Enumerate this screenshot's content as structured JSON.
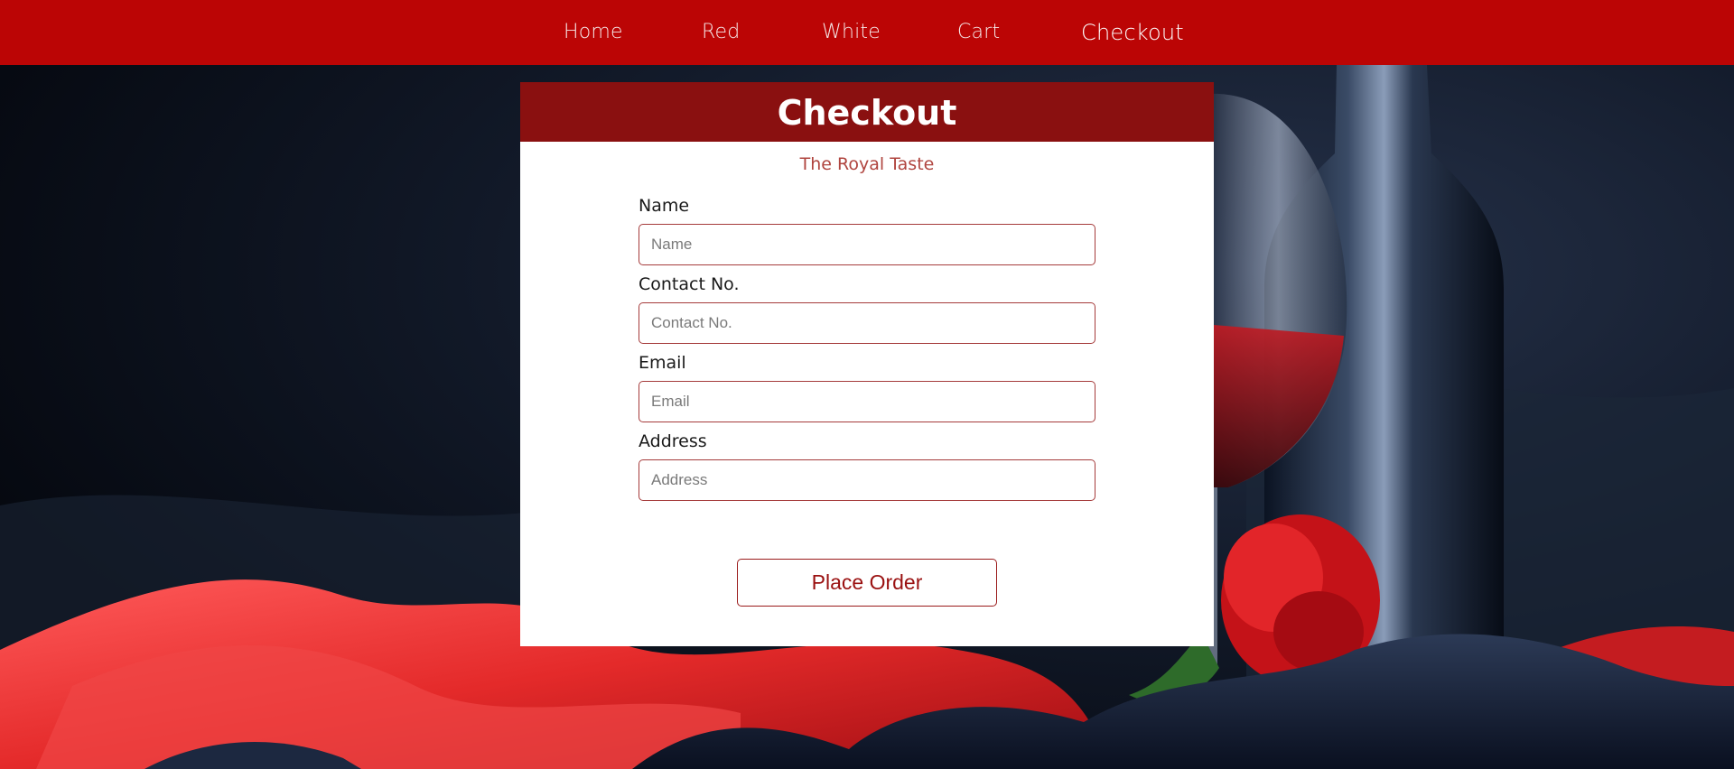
{
  "nav": {
    "items": [
      {
        "label": "Home"
      },
      {
        "label": "Red"
      },
      {
        "label": "White"
      },
      {
        "label": "Cart"
      },
      {
        "label": "Checkout"
      }
    ],
    "active": "Checkout"
  },
  "checkout": {
    "title": "Checkout",
    "subtitle": "The Royal Taste",
    "fields": [
      {
        "label": "Name",
        "placeholder": "Name",
        "value": ""
      },
      {
        "label": "Contact No.",
        "placeholder": "Contact No.",
        "value": ""
      },
      {
        "label": "Email",
        "placeholder": "Email",
        "value": ""
      },
      {
        "label": "Address",
        "placeholder": "Address",
        "value": ""
      }
    ],
    "submit_label": "Place Order"
  },
  "colors": {
    "nav_bg": "#bb0505",
    "header_bg": "#8a1010",
    "subtitle": "#b0453f",
    "input_border": "#a53b3b",
    "button_text": "#9a1010",
    "card_bg": "#ffffff"
  },
  "background": {
    "image": "wine-bottle-glass-rose-red-silk-photo"
  }
}
